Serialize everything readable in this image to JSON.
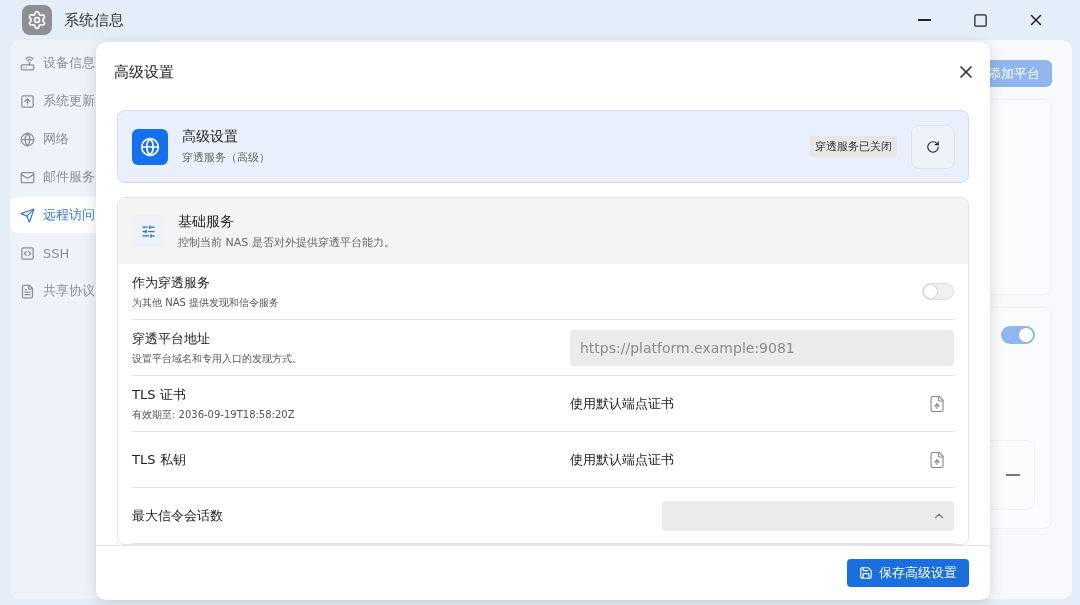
{
  "window": {
    "title": "系统信息"
  },
  "sidebar": {
    "items": [
      {
        "label": "设备信息",
        "selected": false
      },
      {
        "label": "系统更新",
        "selected": false
      },
      {
        "label": "网络",
        "selected": false
      },
      {
        "label": "邮件服务",
        "selected": false
      },
      {
        "label": "远程访问",
        "selected": true
      },
      {
        "label": "SSH",
        "selected": false
      },
      {
        "label": "共享协议",
        "selected": false
      }
    ]
  },
  "background": {
    "add_button": "添加平台",
    "toggle": {
      "on": true
    }
  },
  "dialog": {
    "title": "高级设置",
    "header_card": {
      "title": "高级设置",
      "subtitle": "穿透服务（高级）",
      "badge": "穿透服务已关闭"
    },
    "section": {
      "title": "基础服务",
      "description": "控制当前 NAS 是否对外提供穿透平台能力。",
      "rows": [
        {
          "kind": "toggle",
          "label": "作为穿透服务",
          "hint": "为其他 NAS 提供发现和信令服务",
          "on": false
        },
        {
          "kind": "field",
          "label": "穿透平台地址",
          "hint": "设置平台域名和专用入口的发现方式。",
          "placeholder": "https://platform.example:9081"
        },
        {
          "kind": "file",
          "label": "TLS 证书",
          "hint": "有效期至: 2036-09-19T18:58:20Z",
          "value": "使用默认端点证书"
        },
        {
          "kind": "file",
          "label": "TLS 私钥",
          "value": "使用默认端点证书"
        },
        {
          "kind": "select",
          "label": "最大信令会话数"
        }
      ]
    },
    "save_button": "保存高级设置"
  }
}
